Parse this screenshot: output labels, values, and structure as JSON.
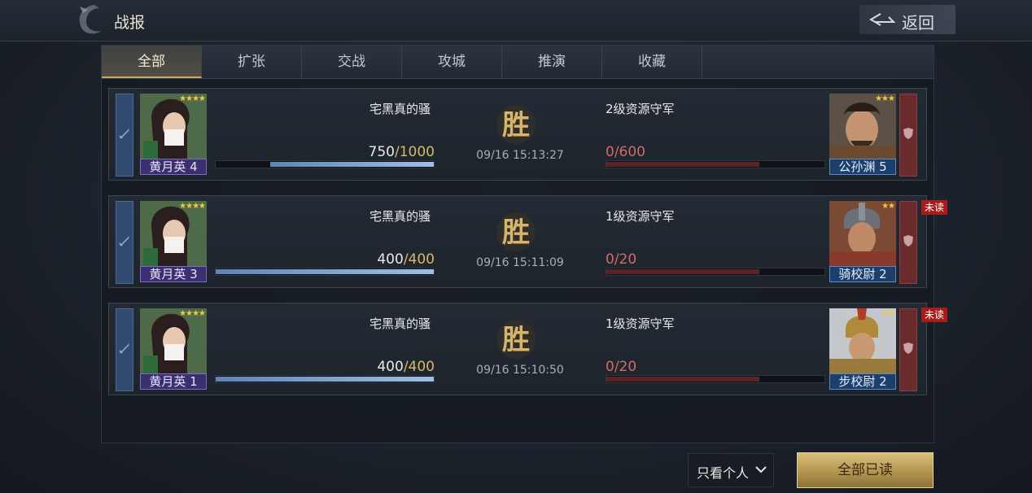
{
  "header": {
    "title": "战报",
    "back_label": "返回"
  },
  "tabs": [
    {
      "label": "全部",
      "active": true
    },
    {
      "label": "扩张",
      "active": false
    },
    {
      "label": "交战",
      "active": false
    },
    {
      "label": "攻城",
      "active": false
    },
    {
      "label": "推演",
      "active": false
    },
    {
      "label": "收藏",
      "active": false
    }
  ],
  "reports": [
    {
      "attacker": {
        "player": "宅黑真的骚",
        "hero": "黄月英",
        "level": "4",
        "stars": "★★★★",
        "troops_current": "750",
        "troops_max": "/1000",
        "troops_ratio": 0.75
      },
      "result_icon": "victory-seal-icon",
      "time": "09/16 15:13:27",
      "defender": {
        "name": "2级资源守军",
        "hero": "公孙渊",
        "level": "5",
        "stars": "★★★",
        "troops": "0/600",
        "troops_ratio": 0.7
      },
      "unread": ""
    },
    {
      "attacker": {
        "player": "宅黑真的骚",
        "hero": "黄月英",
        "level": "3",
        "stars": "★★★★",
        "troops_current": "400",
        "troops_max": "/400",
        "troops_ratio": 1.0
      },
      "result_icon": "victory-seal-icon",
      "time": "09/16 15:11:09",
      "defender": {
        "name": "1级资源守军",
        "hero": "骑校尉",
        "level": "2",
        "stars": "★★",
        "troops": "0/20",
        "troops_ratio": 0.7
      },
      "unread": "未读"
    },
    {
      "attacker": {
        "player": "宅黑真的骚",
        "hero": "黄月英",
        "level": "1",
        "stars": "★★★★",
        "troops_current": "400",
        "troops_max": "/400",
        "troops_ratio": 1.0
      },
      "result_icon": "victory-seal-icon",
      "time": "09/16 15:10:50",
      "defender": {
        "name": "1级资源守军",
        "hero": "步校尉",
        "level": "2",
        "stars": "★★",
        "troops": "0/20",
        "troops_ratio": 0.7
      },
      "unread": "未读"
    }
  ],
  "footer": {
    "filter_label": "只看个人",
    "read_all_label": "全部已读"
  },
  "colors": {
    "accent_gold": "#c8a868",
    "attacker_blue": "#334a70",
    "defender_red": "#6b2b2d",
    "unread_red": "#a81b1b"
  }
}
